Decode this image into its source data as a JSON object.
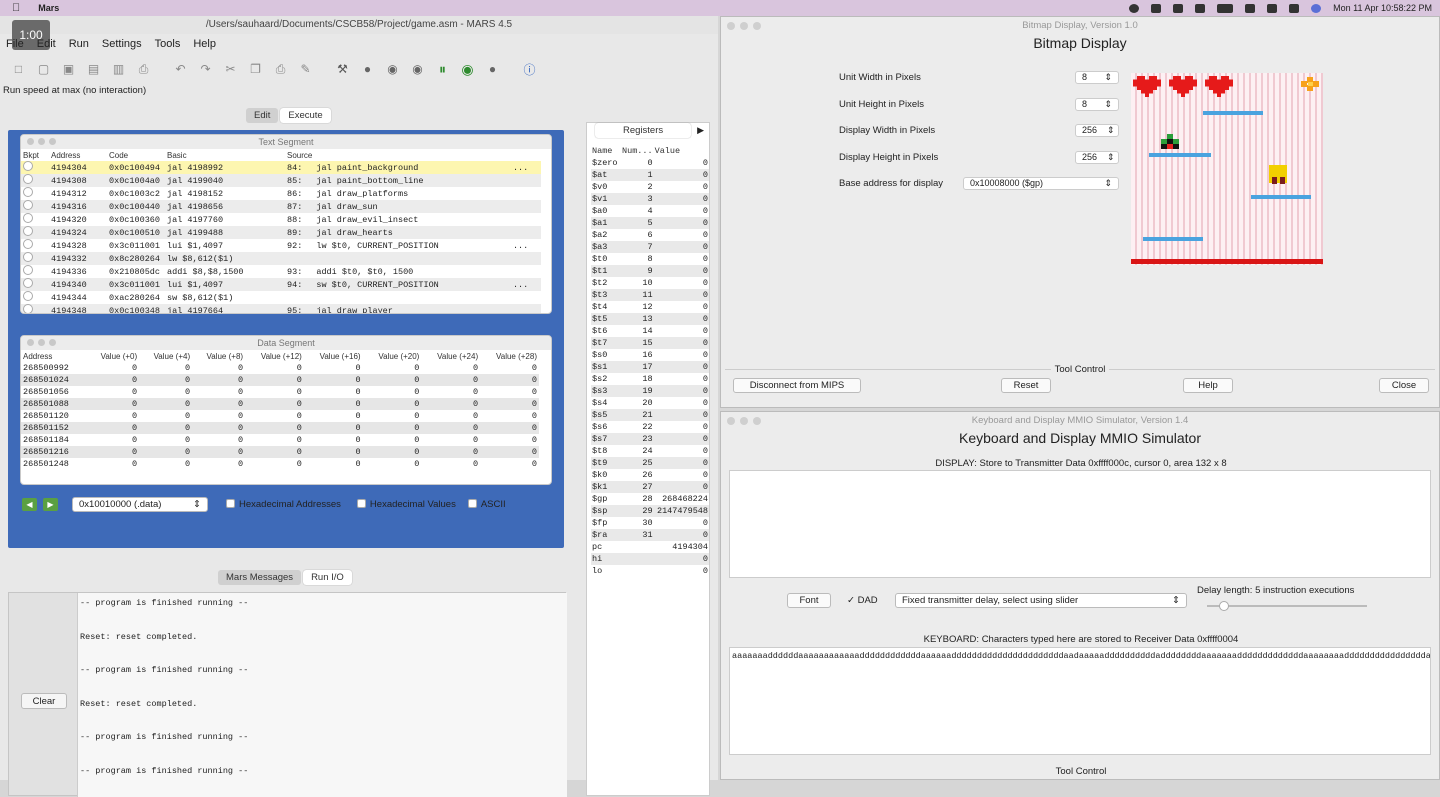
{
  "menubar": {
    "apple": "",
    "app": "Mars",
    "clock": "Mon 11 Apr  10:58:22 PM"
  },
  "video_badge": "1:00",
  "mars": {
    "title": "/Users/sauhaard/Documents/CSCB58/Project/game.asm - MARS 4.5",
    "menu": [
      "File",
      "Edit",
      "Run",
      "Settings",
      "Tools",
      "Help"
    ],
    "run_speed": "Run speed at max (no interaction)",
    "tabs": {
      "edit": "Edit",
      "execute": "Execute"
    },
    "text_segment": {
      "title": "Text Segment",
      "headers": [
        "Bkpt",
        "Address",
        "Code",
        "Basic",
        "Source"
      ],
      "rows": [
        {
          "address": "4194304",
          "code": "0x0c100494",
          "basic": "jal 4198992",
          "line": "84:",
          "source": "jal paint_background",
          "more": "..."
        },
        {
          "address": "4194308",
          "code": "0x0c1004a0",
          "basic": "jal 4199040",
          "line": "85:",
          "source": "jal paint_bottom_line",
          "more": ""
        },
        {
          "address": "4194312",
          "code": "0x0c1003c2",
          "basic": "jal 4198152",
          "line": "86:",
          "source": "jal draw_platforms",
          "more": ""
        },
        {
          "address": "4194316",
          "code": "0x0c100440",
          "basic": "jal 4198656",
          "line": "87:",
          "source": "jal draw_sun",
          "more": ""
        },
        {
          "address": "4194320",
          "code": "0x0c100360",
          "basic": "jal 4197760",
          "line": "88:",
          "source": "jal draw_evil_insect",
          "more": ""
        },
        {
          "address": "4194324",
          "code": "0x0c100510",
          "basic": "jal 4199488",
          "line": "89:",
          "source": "jal draw_hearts",
          "more": ""
        },
        {
          "address": "4194328",
          "code": "0x3c011001",
          "basic": "lui $1,4097",
          "line": "92:",
          "source": "lw $t0, CURRENT_POSITION",
          "more": "..."
        },
        {
          "address": "4194332",
          "code": "0x8c280264",
          "basic": "lw $8,612($1)",
          "line": "",
          "source": "",
          "more": ""
        },
        {
          "address": "4194336",
          "code": "0x210805dc",
          "basic": "addi $8,$8,1500",
          "line": "93:",
          "source": "addi $t0, $t0, 1500",
          "more": ""
        },
        {
          "address": "4194340",
          "code": "0x3c011001",
          "basic": "lui $1,4097",
          "line": "94:",
          "source": "sw $t0, CURRENT_POSITION",
          "more": "..."
        },
        {
          "address": "4194344",
          "code": "0xac280264",
          "basic": "sw $8,612($1)",
          "line": "",
          "source": "",
          "more": ""
        },
        {
          "address": "4194348",
          "code": "0x0c100348",
          "basic": "jal 4197664",
          "line": "95:",
          "source": "jal draw_player",
          "more": ""
        }
      ]
    },
    "data_segment": {
      "title": "Data Segment",
      "headers": [
        "Address",
        "Value (+0)",
        "Value (+4)",
        "Value (+8)",
        "Value (+12)",
        "Value (+16)",
        "Value (+20)",
        "Value (+24)",
        "Value (+28)"
      ],
      "rows": [
        [
          "268500992",
          "0",
          "0",
          "0",
          "0",
          "0",
          "0",
          "0",
          "0"
        ],
        [
          "268501024",
          "0",
          "0",
          "0",
          "0",
          "0",
          "0",
          "0",
          "0"
        ],
        [
          "268501056",
          "0",
          "0",
          "0",
          "0",
          "0",
          "0",
          "0",
          "0"
        ],
        [
          "268501088",
          "0",
          "0",
          "0",
          "0",
          "0",
          "0",
          "0",
          "0"
        ],
        [
          "268501120",
          "0",
          "0",
          "0",
          "0",
          "0",
          "0",
          "0",
          "0"
        ],
        [
          "268501152",
          "0",
          "0",
          "0",
          "0",
          "0",
          "0",
          "0",
          "0"
        ],
        [
          "268501184",
          "0",
          "0",
          "0",
          "0",
          "0",
          "0",
          "0",
          "0"
        ],
        [
          "268501216",
          "0",
          "0",
          "0",
          "0",
          "0",
          "0",
          "0",
          "0"
        ],
        [
          "268501248",
          "0",
          "0",
          "0",
          "0",
          "0",
          "0",
          "0",
          "0"
        ]
      ],
      "segment_select": "0x10010000 (.data)",
      "hex_addresses": "Hexadecimal Addresses",
      "hex_values": "Hexadecimal Values",
      "ascii": "ASCII"
    },
    "messages": {
      "tabs": {
        "mars": "Mars Messages",
        "runio": "Run I/O"
      },
      "clear": "Clear",
      "lines": [
        "-- program is finished running --",
        "",
        "Reset: reset completed.",
        "",
        "-- program is finished running --",
        "",
        "Reset: reset completed.",
        "",
        "-- program is finished running --",
        "",
        "-- program is finished running --"
      ]
    },
    "registers": {
      "tab": "Registers",
      "headers": [
        "Name",
        "Num...",
        "Value"
      ],
      "rows": [
        [
          "$zero",
          "0",
          "0"
        ],
        [
          "$at",
          "1",
          "0"
        ],
        [
          "$v0",
          "2",
          "0"
        ],
        [
          "$v1",
          "3",
          "0"
        ],
        [
          "$a0",
          "4",
          "0"
        ],
        [
          "$a1",
          "5",
          "0"
        ],
        [
          "$a2",
          "6",
          "0"
        ],
        [
          "$a3",
          "7",
          "0"
        ],
        [
          "$t0",
          "8",
          "0"
        ],
        [
          "$t1",
          "9",
          "0"
        ],
        [
          "$t2",
          "10",
          "0"
        ],
        [
          "$t3",
          "11",
          "0"
        ],
        [
          "$t4",
          "12",
          "0"
        ],
        [
          "$t5",
          "13",
          "0"
        ],
        [
          "$t6",
          "14",
          "0"
        ],
        [
          "$t7",
          "15",
          "0"
        ],
        [
          "$s0",
          "16",
          "0"
        ],
        [
          "$s1",
          "17",
          "0"
        ],
        [
          "$s2",
          "18",
          "0"
        ],
        [
          "$s3",
          "19",
          "0"
        ],
        [
          "$s4",
          "20",
          "0"
        ],
        [
          "$s5",
          "21",
          "0"
        ],
        [
          "$s6",
          "22",
          "0"
        ],
        [
          "$s7",
          "23",
          "0"
        ],
        [
          "$t8",
          "24",
          "0"
        ],
        [
          "$t9",
          "25",
          "0"
        ],
        [
          "$k0",
          "26",
          "0"
        ],
        [
          "$k1",
          "27",
          "0"
        ],
        [
          "$gp",
          "28",
          "268468224"
        ],
        [
          "$sp",
          "29",
          "2147479548"
        ],
        [
          "$fp",
          "30",
          "0"
        ],
        [
          "$ra",
          "31",
          "0"
        ],
        [
          "pc",
          "",
          "4194304"
        ],
        [
          "hi",
          "",
          "0"
        ],
        [
          "lo",
          "",
          "0"
        ]
      ]
    }
  },
  "bitmap": {
    "window_title": "Bitmap Display, Version 1.0",
    "title": "Bitmap Display",
    "settings": [
      {
        "label": "Unit Width in Pixels",
        "value": "8"
      },
      {
        "label": "Unit Height in Pixels",
        "value": "8"
      },
      {
        "label": "Display Width in Pixels",
        "value": "256"
      },
      {
        "label": "Display Height in Pixels",
        "value": "256"
      },
      {
        "label": "Base address for display",
        "value": "0x10008000 ($gp)"
      }
    ],
    "tool_control": "Tool Control",
    "buttons": {
      "disconnect": "Disconnect from MIPS",
      "reset": "Reset",
      "help": "Help",
      "close": "Close"
    },
    "colors": {
      "heart": "#e61a1a",
      "platform": "#4aa3df",
      "ground": "#d91515",
      "sun": "#f7a21b"
    }
  },
  "mmio": {
    "window_title": "Keyboard and Display MMIO Simulator, Version 1.4",
    "title": "Keyboard and Display MMIO Simulator",
    "display_label": "DISPLAY: Store to Transmitter Data 0xffff000c, cursor 0, area 132 x 8",
    "font_btn": "Font",
    "dad": "DAD",
    "delay_select": "Fixed transmitter delay, select using slider",
    "delay_length": "Delay length: 5 instruction executions",
    "keyboard_label": "KEYBOARD: Characters typed here are stored to Receiver Data 0xffff0004",
    "keyboard_text": "aaaaaaaddddddaaaaaaaaaaaaddddddddddddaaaaaaddddddddddddddddddddddaadaaaaaddddddddddaddddddddaaaaaaadddddddddddddaaaaaaaaddddddddddddddddaaaaaaaaadddddddddddd",
    "tool_control": "Tool Control"
  }
}
